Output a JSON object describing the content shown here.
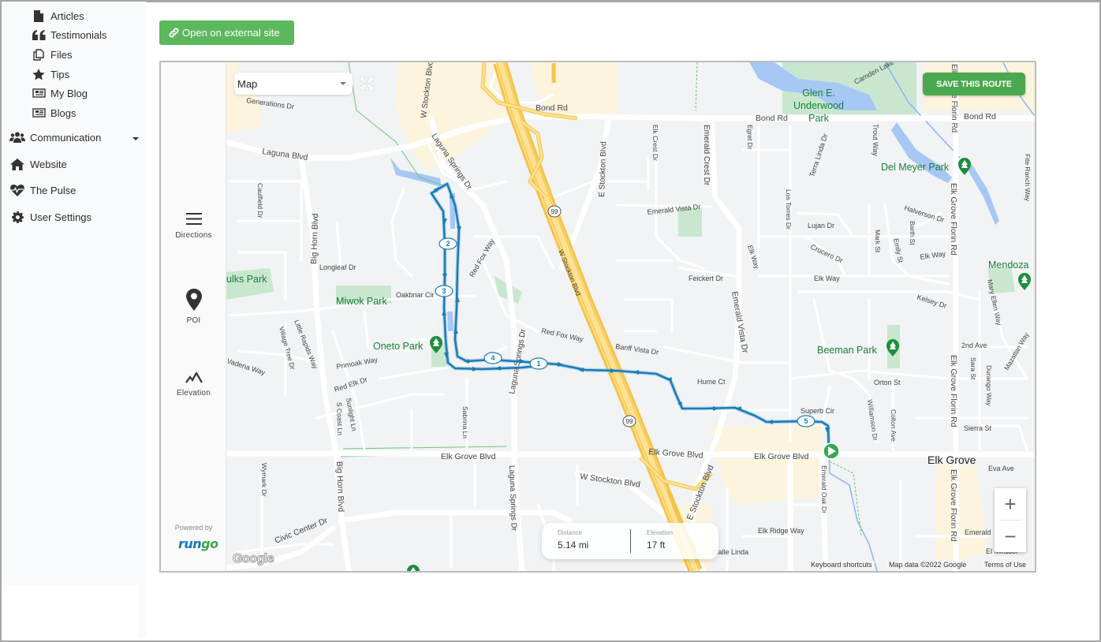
{
  "sidebar": {
    "sub_items": [
      {
        "label": "Articles",
        "icon": "file-icon"
      },
      {
        "label": "Testimonials",
        "icon": "quote-icon"
      },
      {
        "label": "Files",
        "icon": "files-icon"
      },
      {
        "label": "Tips",
        "icon": "star-icon"
      },
      {
        "label": "My Blog",
        "icon": "newspaper-icon"
      },
      {
        "label": "Blogs",
        "icon": "newspaper-icon"
      }
    ],
    "items": [
      {
        "label": "Communication",
        "icon": "users-icon",
        "has_dropdown": true
      },
      {
        "label": "Website",
        "icon": "home-icon"
      },
      {
        "label": "The Pulse",
        "icon": "heartbeat-icon"
      },
      {
        "label": "User Settings",
        "icon": "gear-icon"
      }
    ]
  },
  "toolbar": {
    "external_label": "Open on external site"
  },
  "map": {
    "type_select": "Map",
    "save_label": "SAVE THIS ROUTE",
    "panel": {
      "directions": "Directions",
      "poi": "POI",
      "elevation": "Elevation",
      "powered_by": "Powered by",
      "brand_left": "run",
      "brand_right": "go"
    },
    "stats": {
      "distance_label": "Distance",
      "distance_value": "5.14 mi",
      "elevation_label": "Elevation",
      "elevation_value": "17 ft"
    },
    "zoom_in": "+",
    "zoom_out": "−",
    "attribution": {
      "shortcuts": "Keyboard shortcuts",
      "map_data": "Map data ©2022 Google",
      "terms": "Terms of Use",
      "google": "Google"
    },
    "route_markers": [
      "1",
      "2",
      "3",
      "4",
      "5"
    ],
    "route_color": "#1a7fae",
    "labels": {
      "bond_rd_1": "Bond Rd",
      "bond_rd_2": "Bond Rd",
      "bond_rd_3": "Bond Rd",
      "laguna_blvd": "Laguna Blvd",
      "generations_dr": "Generations Dr",
      "w_stockton_top": "W Stockton Blvd",
      "laguna_springs_top": "Laguna Springs Dr",
      "e_stockton_top": "E Stockton Blvd",
      "elk_crest": "Elk Crest Dr",
      "emerald_crest": "Emerald Crest Dr",
      "egret_dr": "Egret Dr",
      "terra_linda": "Terra Linda Dr",
      "trout_way": "Trout Way",
      "camden_lake": "Camden Lake Way",
      "glen_park_1": "Glen E.",
      "glen_park_2": "Underwood",
      "glen_park_3": "Park",
      "del_meyer": "Del Meyer Park",
      "fite_ranch": "Fite Ranch Way",
      "elk_grove_florin_1": "Elk Grove Florin Rd",
      "elk_grove_florin_2": "Elk Grove Florin Rd",
      "elk_grove_florin_3": "Elk Grove Florin Rd",
      "caulfield": "Caulfield Dr",
      "big_horn_1": "Big Horn Blvd",
      "big_horn_2": "Big Horn Blvd",
      "longleaf": "Longleaf Dr",
      "faulks_park": "ulks Park",
      "miwok_park": "Miwok Park",
      "oakbriar": "Oakbriar Cir",
      "oneto_park": "Oneto Park",
      "red_fox_1": "Red Fox Way",
      "red_fox_2": "Red Fox Way",
      "primoak": "Primoak Way",
      "red_elk": "Red Elk Dr",
      "vadena": "Vadena Way",
      "village_tree": "Village Tree Dr",
      "little_rapids": "Little Rapids Way",
      "sunlight": "Sunlight Ln",
      "s_coast": "S Coast Ln",
      "sabrina": "Sabrina Ln",
      "laguna_springs_mid": "Laguna Springs Dr",
      "laguna_springs_bot": "Laguna Springs Dr",
      "w_stockton_mid": "W Stockton Blvd",
      "w_stockton_bot": "W Stockton Blvd",
      "emerald_vista_dr": "Emerald Vista Dr",
      "emerald_vista_main": "Emerald Vista Dr",
      "feickert": "Feickert Dr",
      "banff_vista": "Banff Vista Dr",
      "hume_ct": "Hume Ct",
      "elk_way_1": "Elk Way",
      "elk_way_2": "Elk Way",
      "elk_way_3": "Elk Way",
      "los_torres": "Los Torres Dr",
      "lujan": "Lujan Dr",
      "crucero": "Crucero Dr",
      "halverson": "Halverson Dr",
      "mark_st": "Mark St",
      "emily_st": "Emily St",
      "barth_st": "Barth St",
      "kelsey": "Kelsey Dr",
      "beeman_park": "Beeman Park",
      "orton_st": "Orton St",
      "superb_cir": "Superb Cir",
      "williamson": "Williamson Dr",
      "colton": "Colton Ave",
      "mendoza": "Mendoza",
      "mary_ellen": "Mary Ellen Way",
      "mazatlan": "Mazatlan Way",
      "second_ave": "2nd Ave",
      "sara_st": "Sara St",
      "durango": "Durango Way",
      "sierra_st": "Sierra St",
      "eva_ave": "Eva Ave",
      "elk_grove_city": "Elk Grove",
      "elk_grove_blvd_1": "Elk Grove Blvd",
      "elk_grove_blvd_2": "Elk Grove Blvd",
      "elk_grove_blvd_3": "Elk Grove Blvd",
      "e_stockton_bot": "E Stockton Blvd",
      "wymark": "Wymark Dr",
      "civic_center": "Civic Center Dr",
      "elk_ridge": "Elk Ridge Way",
      "calle_linda": "Calle Linda",
      "emerald_oak": "Emerald Oak Dr",
      "emerald_bot": "Emerald",
      "el_mirador": "El Mirador",
      "hwy_99": "99"
    }
  }
}
